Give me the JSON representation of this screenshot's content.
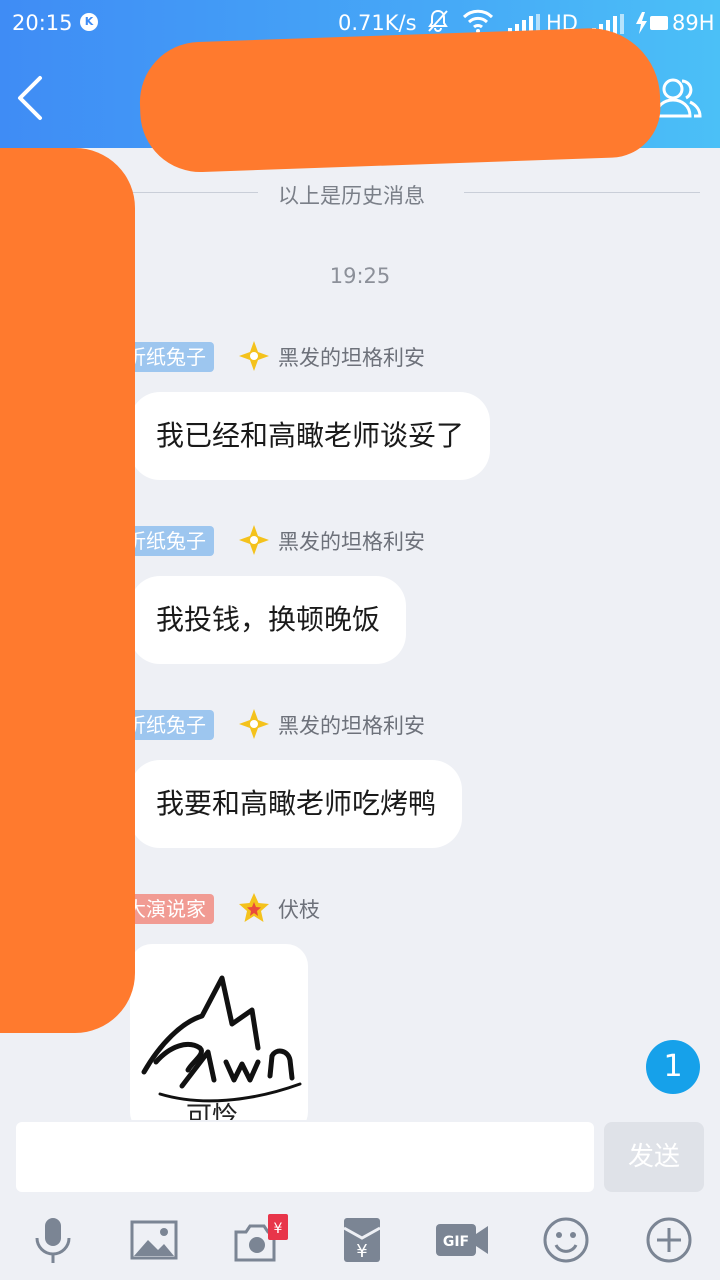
{
  "status_bar": {
    "time": "20:15",
    "app_icon": "K",
    "net_speed": "0.71K/s",
    "hd_label": "HD",
    "battery_text": "89H"
  },
  "nav": {
    "title": "",
    "back_icon": "chevron-left-icon",
    "profile_icon": "group-profile-icon"
  },
  "chat": {
    "history_divider": "以上是历史消息",
    "timestamp": "19:25",
    "messages": [
      {
        "badge": "折纸兔子",
        "badge_color": "#9dc6ef",
        "sender": "黑发的坦格利安",
        "text": "我已经和高瞰老师谈妥了"
      },
      {
        "badge": "折纸兔子",
        "badge_color": "#9dc6ef",
        "sender": "黑发的坦格利安",
        "text": "我投钱，换顿晚饭"
      },
      {
        "badge": "折纸兔子",
        "badge_color": "#9dc6ef",
        "sender": "黑发的坦格利安",
        "text": "我要和高瞰老师吃烤鸭"
      },
      {
        "badge": "大演说家",
        "badge_color": "#f19b93",
        "sender": "伏枝",
        "sticker_caption": "可怜"
      }
    ],
    "unread_count": "1"
  },
  "input": {
    "value": "",
    "placeholder": "",
    "send_label": "发送"
  },
  "toolbar": {
    "icons": [
      "microphone-icon",
      "image-icon",
      "camera-redpacket-icon",
      "red-envelope-icon",
      "gif-icon",
      "emoji-icon",
      "plus-icon"
    ]
  },
  "colors": {
    "header_gradient_start": "#3f8cf5",
    "header_gradient_end": "#4bc0f7",
    "redaction": "#ff7a2e",
    "unread_badge": "#16a1ea",
    "background": "#eef0f5"
  }
}
